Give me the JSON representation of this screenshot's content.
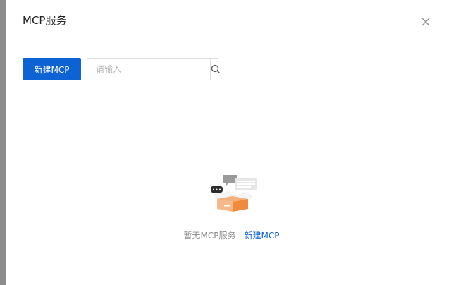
{
  "drawer": {
    "title": "MCP服务",
    "close_icon": "close-icon"
  },
  "toolbar": {
    "new_button_label": "新建MCP",
    "search_placeholder": "请输入",
    "search_icon": "search-icon"
  },
  "empty_state": {
    "illustration": "empty-box-icon",
    "message": "暂无MCP服务",
    "action_label": "新建MCP"
  },
  "colors": {
    "primary": "#0d63d3",
    "illustration_orange": "#f59b4c"
  }
}
